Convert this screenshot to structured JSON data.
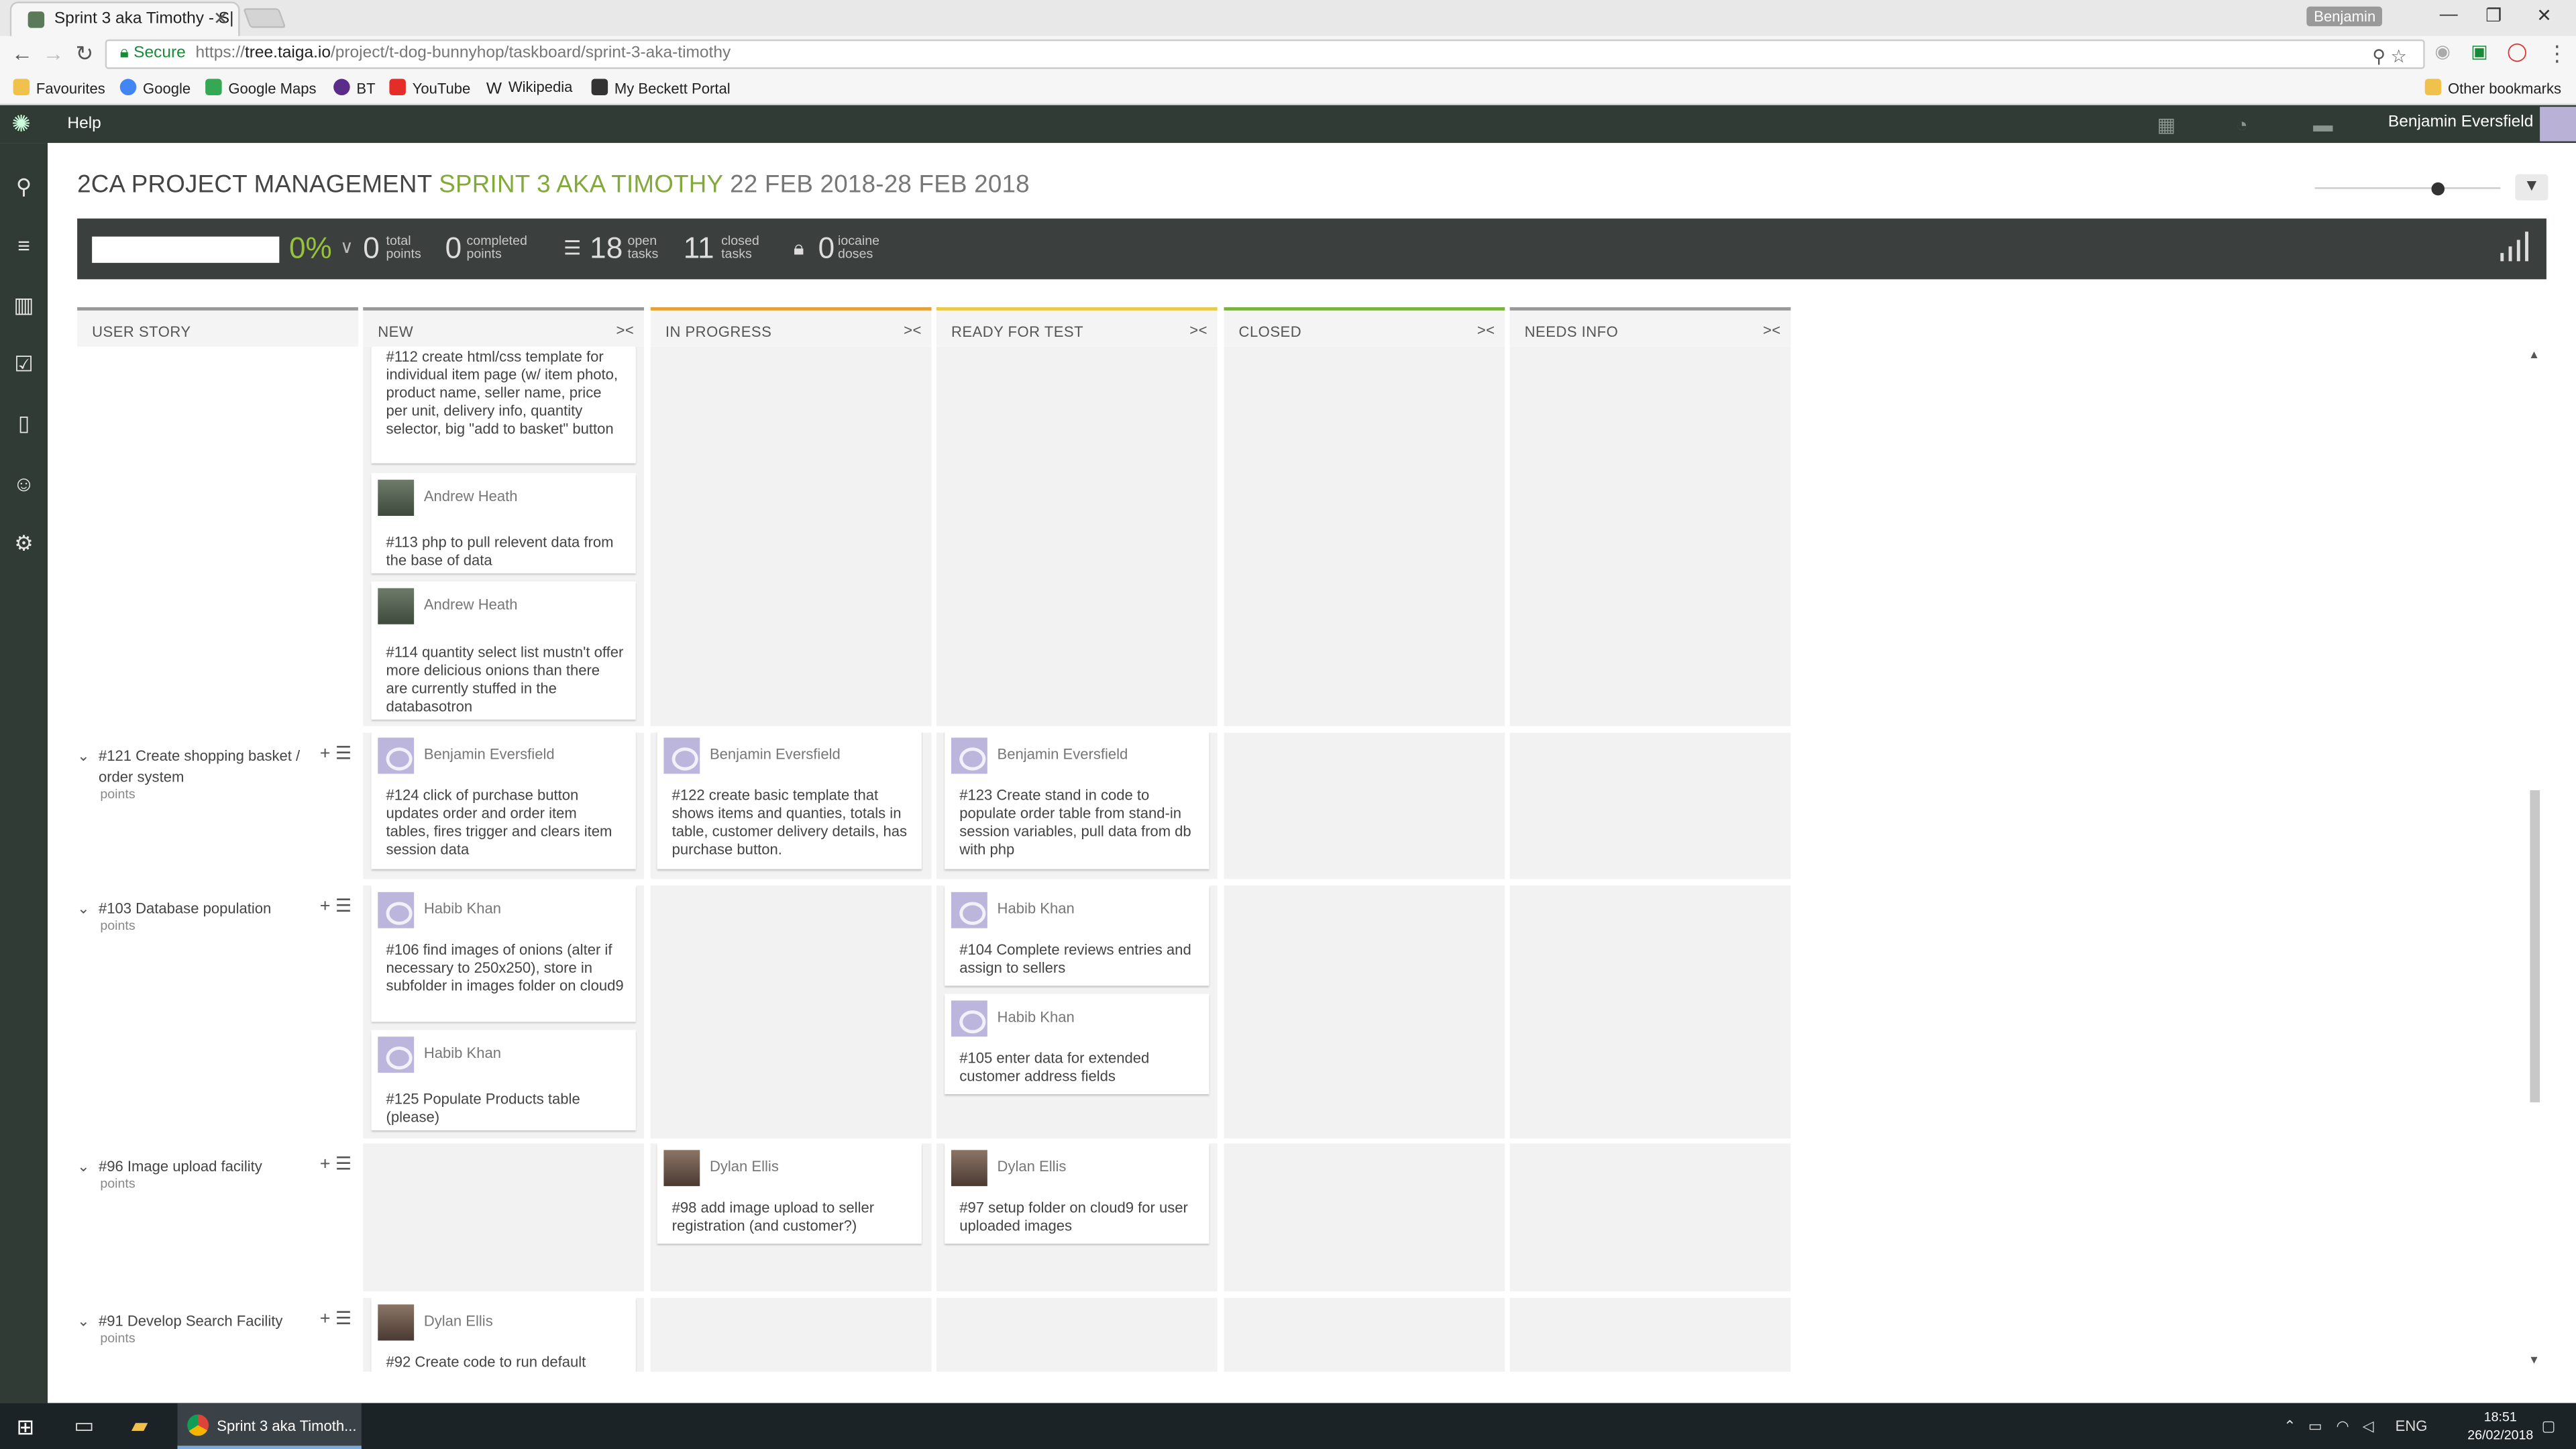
{
  "browser": {
    "tab_title": "Sprint 3 aka Timothy - S|",
    "profile_name": "Benjamin",
    "secure_label": "Secure",
    "url_scheme": "https://",
    "url_host": "tree.taiga.io",
    "url_path": "/project/t-dog-bunnyhop/taskboard/sprint-3-aka-timothy",
    "bookmarks": [
      "Favourites",
      "Google",
      "Google Maps",
      "BT",
      "YouTube",
      "Wikipedia",
      "My Beckett Portal"
    ],
    "other_bookmarks": "Other bookmarks"
  },
  "taiga": {
    "help": "Help",
    "user_name": "Benjamin Eversfield"
  },
  "header": {
    "project": "2CA PROJECT MANAGEMENT",
    "sprint": "SPRINT 3 AKA TIMOTHY",
    "dates": "22 FEB 2018-28 FEB 2018"
  },
  "summary": {
    "progress": "0%",
    "total_points": "0",
    "total_points_label_1": "total",
    "total_points_label_2": "points",
    "completed_points": "0",
    "completed_label_1": "completed",
    "completed_label_2": "points",
    "open_tasks": "18",
    "open_label_1": "open",
    "open_label_2": "tasks",
    "closed_tasks": "11",
    "closed_label_1": "closed",
    "closed_label_2": "tasks",
    "iocaine": "0",
    "iocaine_label_1": "iocaine",
    "iocaine_label_2": "doses"
  },
  "columns": {
    "user_story": "USER STORY",
    "new": "NEW",
    "in_progress": "IN PROGRESS",
    "ready_for_test": "READY FOR TEST",
    "closed": "CLOSED",
    "needs_info": "NEEDS INFO",
    "colors": {
      "new": "#9a9a9a",
      "in_progress": "#e4a23b",
      "ready_for_test": "#e8c94a",
      "closed": "#7ab143",
      "needs_info": "#9a9a9a"
    }
  },
  "stories": {
    "s121": {
      "title": "#121 Create shopping basket / order system",
      "points": "points"
    },
    "s103": {
      "title": "#103 Database population",
      "points": "points"
    },
    "s96": {
      "title": "#96 Image upload facility",
      "points": "points"
    },
    "s91": {
      "title": "#91 Develop Search Facility",
      "points": "points"
    }
  },
  "cards": {
    "t112": {
      "text": "#112 create html/css template for individual item page (w/ item photo, product name, seller name, price per unit, delivery info, quantity selector, big \"add to basket\" button"
    },
    "t113": {
      "assignee": "Andrew Heath",
      "text": "#113 php to pull relevent data from the base of data"
    },
    "t114": {
      "assignee": "Andrew Heath",
      "text": "#114 quantity select list mustn't offer more delicious onions than there are currently stuffed in the databasotron"
    },
    "t124": {
      "assignee": "Benjamin Eversfield",
      "text": "#124 click of purchase button updates order and order item tables, fires trigger and clears item session data"
    },
    "t122": {
      "assignee": "Benjamin Eversfield",
      "text": "#122 create basic template that shows items and quanties, totals in table, customer delivery details, has purchase button."
    },
    "t123": {
      "assignee": "Benjamin Eversfield",
      "text": "#123 Create stand in code to populate order table from stand-in session variables, pull data from db with php"
    },
    "t106": {
      "assignee": "Habib Khan",
      "text": "#106 find images of onions (alter if necessary to 250x250), store in subfolder in images folder on cloud9"
    },
    "t104": {
      "assignee": "Habib Khan",
      "text": "#104 Complete reviews entries and assign to sellers"
    },
    "t125": {
      "assignee": "Habib Khan",
      "text": "#125 Populate Products table (please)"
    },
    "t105": {
      "assignee": "Habib Khan",
      "text": "#105 enter data for extended customer address fields"
    },
    "t98": {
      "assignee": "Dylan Ellis",
      "text": "#98 add image upload to seller registration (and customer?)"
    },
    "t97": {
      "assignee": "Dylan Ellis",
      "text": "#97 setup folder on cloud9 for user uploaded images"
    },
    "t92": {
      "assignee": "Dylan Ellis",
      "text": "#92 Create code to run default"
    }
  },
  "taskbar": {
    "app_title": "Sprint 3 aka Timoth...",
    "lang": "ENG",
    "time": "18:51",
    "date": "26/02/2018"
  }
}
